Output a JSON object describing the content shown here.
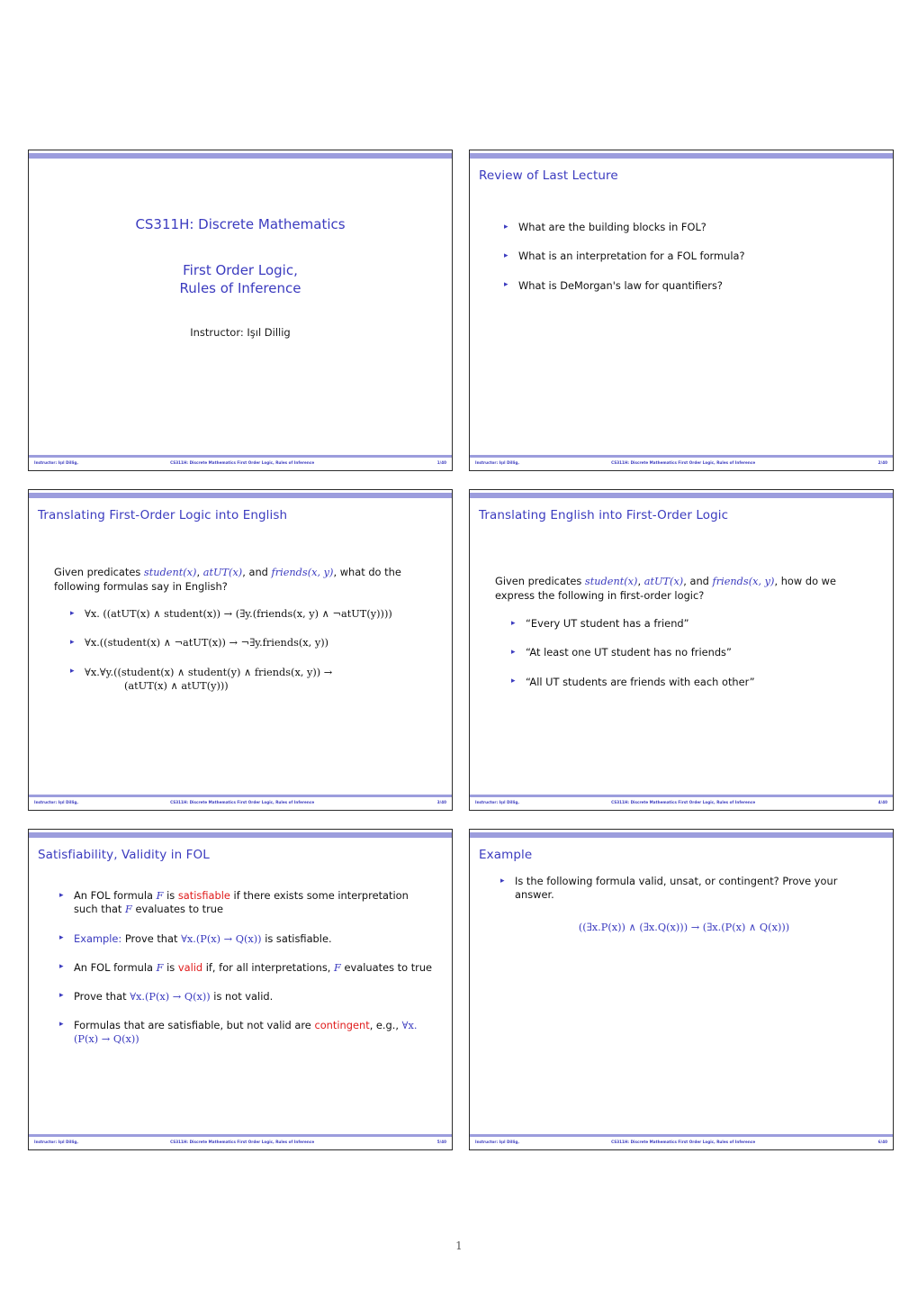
{
  "document": {
    "page_number": "1",
    "accent_blue": "#3b3bbf",
    "bar_lavender": "#9c9ddd",
    "highlight_red": "#e01b1b"
  },
  "footer_common": {
    "left": "Instructor: Işıl Dillig,",
    "center": "CS311H: Discrete Mathematics  First Order Logic,  Rules of Inference"
  },
  "slides": [
    {
      "id": "title-slide",
      "kind": "title",
      "course_title": "CS311H: Discrete Mathematics",
      "lecture_title_line1": "First Order Logic,",
      "lecture_title_line2": "Rules of Inference",
      "instructor": "Instructor: Işıl Dillig",
      "footer_page": "1/40"
    },
    {
      "id": "review-slide",
      "kind": "bullets",
      "title": "Review of Last Lecture",
      "bullets": [
        "What are the building blocks in FOL?",
        "What is an interpretation for a FOL formula?",
        "What is DeMorgan's law for quantifiers?"
      ],
      "footer_page": "2/40"
    },
    {
      "id": "translate-fol-to-english-slide",
      "kind": "translate-fol",
      "title": "Translating First-Order Logic into English",
      "lead_plain_1": "Given predicates ",
      "lead_pred_1": "student(x)",
      "lead_plain_2": ", ",
      "lead_pred_2": "atUT(x)",
      "lead_plain_3": ", and ",
      "lead_pred_3": "friends(x, y)",
      "lead_plain_4": ", what do the following formulas say in English?",
      "formulas": [
        "∀x. ((atUT(x) ∧ student(x)) → (∃y.(friends(x, y) ∧ ¬atUT(y))))",
        "∀x.((student(x) ∧ ¬atUT(x)) → ¬∃y.friends(x, y))",
        "∀x.∀y.((student(x) ∧ student(y) ∧ friends(x, y)) →",
        "(atUT(x) ∧ atUT(y)))"
      ],
      "footer_page": "3/40"
    },
    {
      "id": "translate-english-to-fol-slide",
      "kind": "translate-english",
      "title": "Translating English into First-Order Logic",
      "lead_plain_1": "Given predicates ",
      "lead_pred_1": "student(x)",
      "lead_plain_2": ", ",
      "lead_pred_2": "atUT(x)",
      "lead_plain_3": ", and ",
      "lead_pred_3": "friends(x, y)",
      "lead_plain_4": ", how do we express the following in first-order logic?",
      "bullets": [
        "“Every UT student has a friend”",
        "“At least one UT student has no friends”",
        "“All UT students are friends with each other”"
      ],
      "footer_page": "4/40"
    },
    {
      "id": "satisfiability-validity-slide",
      "kind": "sat-valid",
      "title": "Satisfiability, Validity in FOL",
      "items": [
        {
          "pre": "An FOL formula ",
          "var": "F",
          "mid": " is ",
          "kw": "satisfiable",
          "kw_color": "red",
          "post": " if there exists some interpretation such that ",
          "var2": "F",
          "tail": " evaluates to true"
        },
        {
          "label": "Example:",
          "label_color": "blue",
          "pre": " Prove that ",
          "formula": "∀x.(P(x) → Q(x))",
          "post": " is satisfiable."
        },
        {
          "pre": "An FOL formula ",
          "var": "F",
          "mid": " is ",
          "kw": "valid",
          "kw_color": "red",
          "post": " if, for all interpretations, ",
          "var2": "F",
          "tail": " evaluates to true"
        },
        {
          "pre": "Prove that ",
          "formula": "∀x.(P(x) → Q(x))",
          "post": " is not valid."
        },
        {
          "pre": "Formulas that are satisfiable, but not valid are ",
          "kw": "contingent",
          "kw_color": "red",
          "post": ", e.g., ",
          "formula": "∀x.(P(x) → Q(x))"
        }
      ],
      "footer_page": "5/40"
    },
    {
      "id": "example-slide",
      "kind": "example",
      "title": "Example",
      "bullet": "Is the following formula valid, unsat, or contingent? Prove your answer.",
      "formula": "((∃x.P(x)) ∧ (∃x.Q(x))) → (∃x.(P(x) ∧ Q(x)))",
      "footer_page": "6/40"
    }
  ]
}
